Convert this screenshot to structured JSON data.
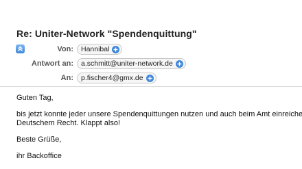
{
  "message": {
    "subject": "Re: Uniter-Network \"Spendenquittung\"",
    "headers": [
      {
        "label": "Von:",
        "value": "Hannibal"
      },
      {
        "label": "Antwort an:",
        "value": "a.schmitt@uniter-network.de"
      },
      {
        "label": "An:",
        "value": "p.fischer4@gmx.de"
      }
    ],
    "body": {
      "greeting": "Guten Tag,",
      "paragraph_line1": "bis jetzt konnte jeder unsere Spendenquittungen nutzen und auch beim Amt einreichen",
      "paragraph_line2": "Deutschem Recht. Klappt also!",
      "closing": "Beste Grüße,",
      "signature": "ihr Backoffice"
    }
  },
  "icons": {
    "collapse": "chevron-up-double-icon",
    "add": "plus-circle-icon"
  },
  "colors": {
    "accent": "#3f86d8"
  }
}
